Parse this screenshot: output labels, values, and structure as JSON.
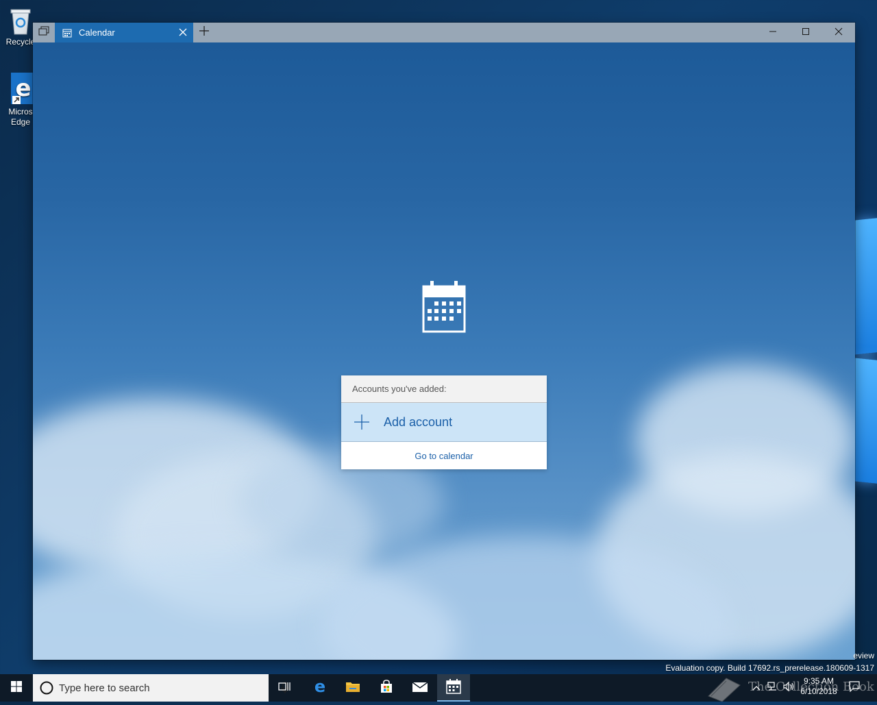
{
  "desktop": {
    "icons": [
      {
        "label": "Recycle"
      },
      {
        "label": "Micros Edge"
      }
    ],
    "eval_line_1": "eview",
    "eval_line_2": "Evaluation copy. Build 17692.rs_prerelease.180609-1317"
  },
  "window": {
    "tab": {
      "label": "Calendar"
    }
  },
  "accounts": {
    "header": "Accounts you've added:",
    "add_label": "Add account",
    "goto_label": "Go to calendar"
  },
  "taskbar": {
    "search_placeholder": "Type here to search",
    "clock": {
      "time": "9:35 AM",
      "date": "6/10/2018"
    },
    "watermark_text": "The Collection Book"
  },
  "colors": {
    "accent": "#1d6bb0",
    "link": "#1a5fa8",
    "add_account_bg": "#cce4f7"
  }
}
